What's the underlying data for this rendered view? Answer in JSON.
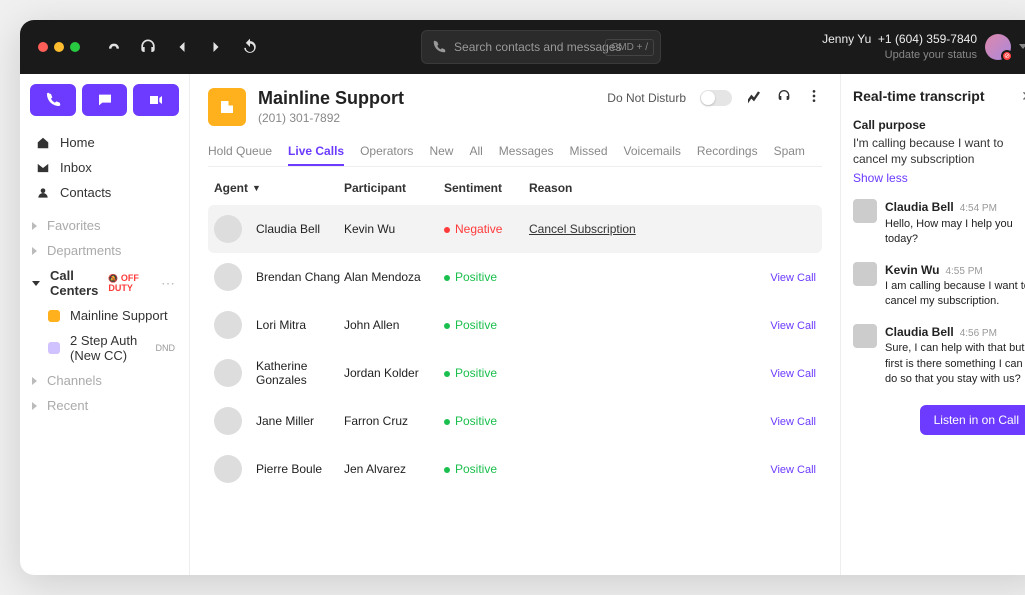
{
  "topbar": {
    "search_placeholder": "Search contacts and messages",
    "kbd": "CMD + /",
    "user_name": "Jenny Yu",
    "user_phone": "+1 (604) 359-7840",
    "user_status": "Update your status"
  },
  "sidebar": {
    "home": "Home",
    "inbox": "Inbox",
    "contacts": "Contacts",
    "favorites": "Favorites",
    "departments": "Departments",
    "call_centers": "Call Centers",
    "off_duty": "OFF DUTY",
    "mainline": "Mainline Support",
    "two_step": "2 Step Auth (New CC)",
    "dnd": "DND",
    "channels": "Channels",
    "recent": "Recent"
  },
  "center": {
    "title": "Mainline Support",
    "phone": "(201) 301-7892",
    "dnd_label": "Do Not Disturb",
    "tabs": [
      "Hold Queue",
      "Live Calls",
      "Operators",
      "New",
      "All",
      "Messages",
      "Missed",
      "Voicemails",
      "Recordings",
      "Spam"
    ],
    "active_tab": 1,
    "cols": {
      "agent": "Agent",
      "participant": "Participant",
      "sentiment": "Sentiment",
      "reason": "Reason"
    },
    "rows": [
      {
        "agent": "Claudia Bell",
        "participant": "Kevin Wu",
        "sentiment": "Negative",
        "sentiment_type": "neg",
        "reason": "Cancel Subscription",
        "view": "",
        "selected": true,
        "avcls": "av1"
      },
      {
        "agent": "Brendan Chang",
        "participant": "Alan Mendoza",
        "sentiment": "Positive",
        "sentiment_type": "pos",
        "reason": "",
        "view": "View Call",
        "selected": false,
        "avcls": "av2"
      },
      {
        "agent": "Lori Mitra",
        "participant": "John Allen",
        "sentiment": "Positive",
        "sentiment_type": "pos",
        "reason": "",
        "view": "View Call",
        "selected": false,
        "avcls": "av3"
      },
      {
        "agent": "Katherine Gonzales",
        "participant": "Jordan Kolder",
        "sentiment": "Positive",
        "sentiment_type": "pos",
        "reason": "",
        "view": "View Call",
        "selected": false,
        "avcls": "av4"
      },
      {
        "agent": "Jane Miller",
        "participant": "Farron Cruz",
        "sentiment": "Positive",
        "sentiment_type": "pos",
        "reason": "",
        "view": "View Call",
        "selected": false,
        "avcls": "av5"
      },
      {
        "agent": "Pierre Boule",
        "participant": "Jen Alvarez",
        "sentiment": "Positive",
        "sentiment_type": "pos",
        "reason": "",
        "view": "View Call",
        "selected": false,
        "avcls": "av6"
      }
    ]
  },
  "panel": {
    "title": "Real-time transcript",
    "purpose_label": "Call purpose",
    "purpose_text": "I'm calling because I want to cancel my subscription",
    "show_less": "Show less",
    "transcript": [
      {
        "from": "Claudia Bell",
        "time": "4:54 PM",
        "text": "Hello, How may I help you today?",
        "avcls": "av7"
      },
      {
        "from": "Kevin Wu",
        "time": "4:55 PM",
        "text": "I am calling because I want to cancel my subscription.",
        "avcls": "av8"
      },
      {
        "from": "Claudia Bell",
        "time": "4:56 PM",
        "text": "Sure, I can help with that but first is there something I can do so that you stay with us?",
        "avcls": "av7"
      }
    ],
    "listen_label": "Listen in on Call"
  }
}
